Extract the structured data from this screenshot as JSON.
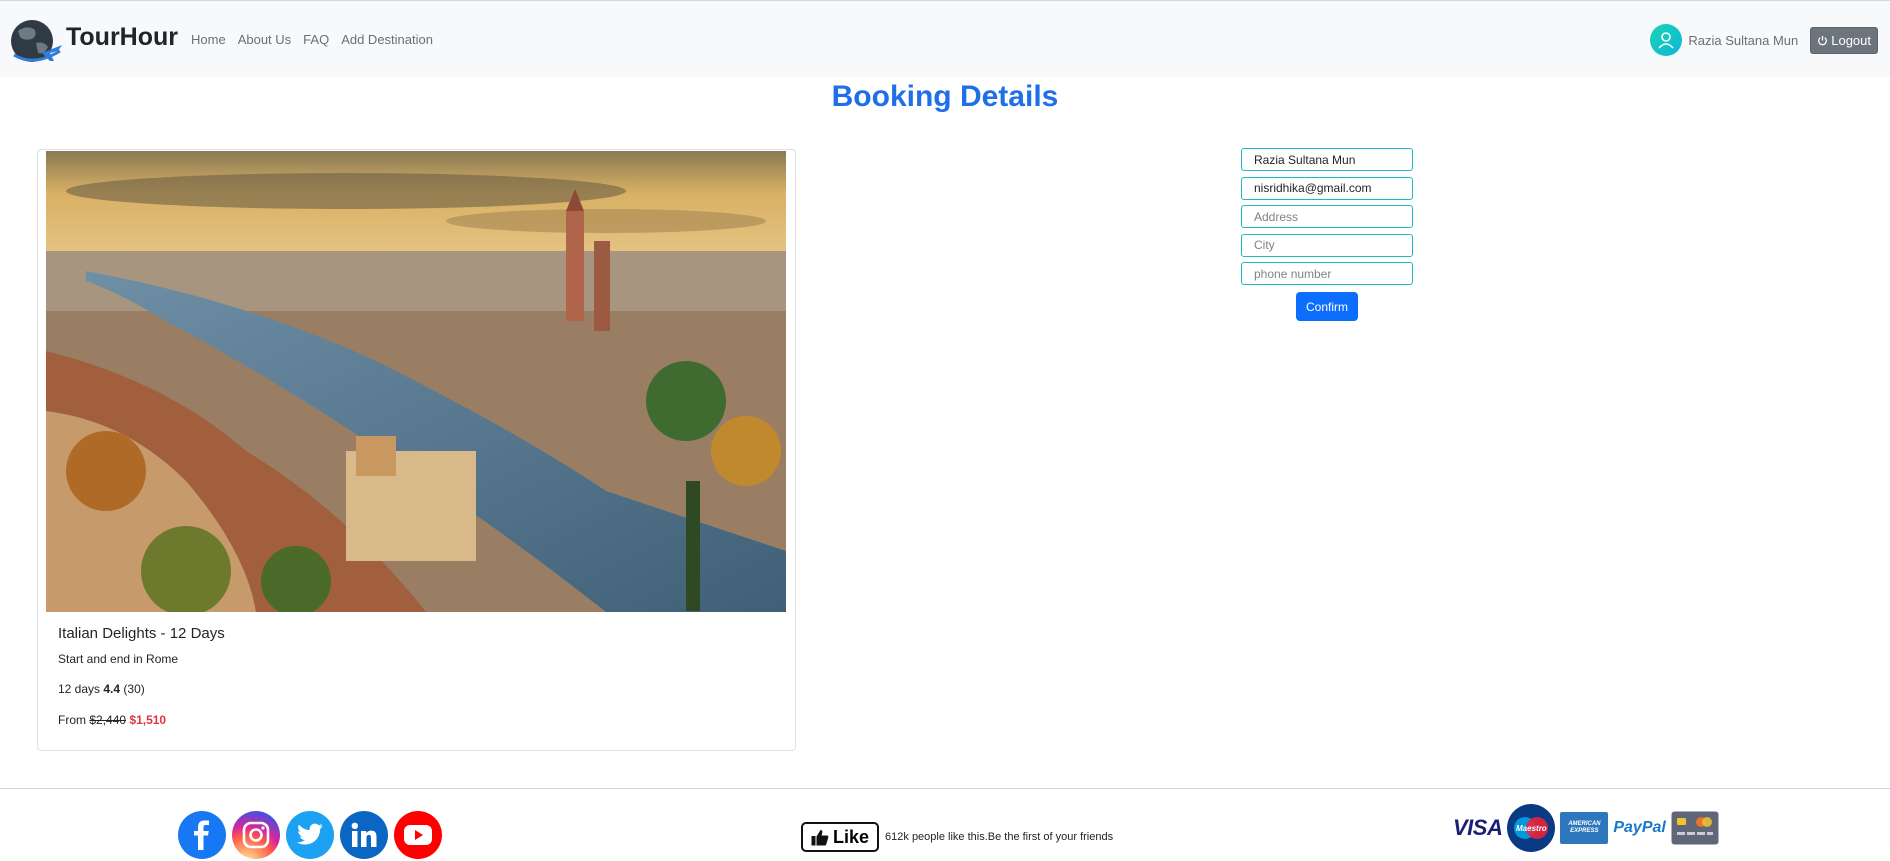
{
  "brand": {
    "name": "TourHour"
  },
  "nav": {
    "links": [
      "Home",
      "About Us",
      "FAQ",
      "Add Destination"
    ]
  },
  "user": {
    "name": "Razia Sultana Mun",
    "logout_label": "Logout"
  },
  "page": {
    "title": "Booking Details"
  },
  "tour_card": {
    "title": "Italian Delights - 12 Days",
    "subtitle": "Start and end in Rome",
    "duration": "12 days",
    "rating": "4.4",
    "reviews": "(30)",
    "price_prefix": "From",
    "old_price": "$2,440",
    "new_price": "$1,510"
  },
  "form": {
    "name_value": "Razia Sultana Mun",
    "email_value": "nisridhika@gmail.com",
    "address_placeholder": "Address",
    "city_placeholder": "City",
    "phone_placeholder": "phone number",
    "confirm_label": "Confirm"
  },
  "footer": {
    "social_icons": [
      "facebook-icon",
      "instagram-icon",
      "twitter-icon",
      "linkedin-icon",
      "youtube-icon"
    ],
    "like_label": "Like",
    "like_text": "612k people like this.Be the first of your friends",
    "payment_logos": {
      "visa": "VISA",
      "maestro": "Maestro",
      "amex": "AMERICAN EXPRESS",
      "paypal": "PayPal"
    }
  },
  "colors": {
    "accent": "#1e6fe8",
    "confirm": "#0d6efd",
    "sale": "#dc3545",
    "input_border": "#1fb8c4"
  }
}
